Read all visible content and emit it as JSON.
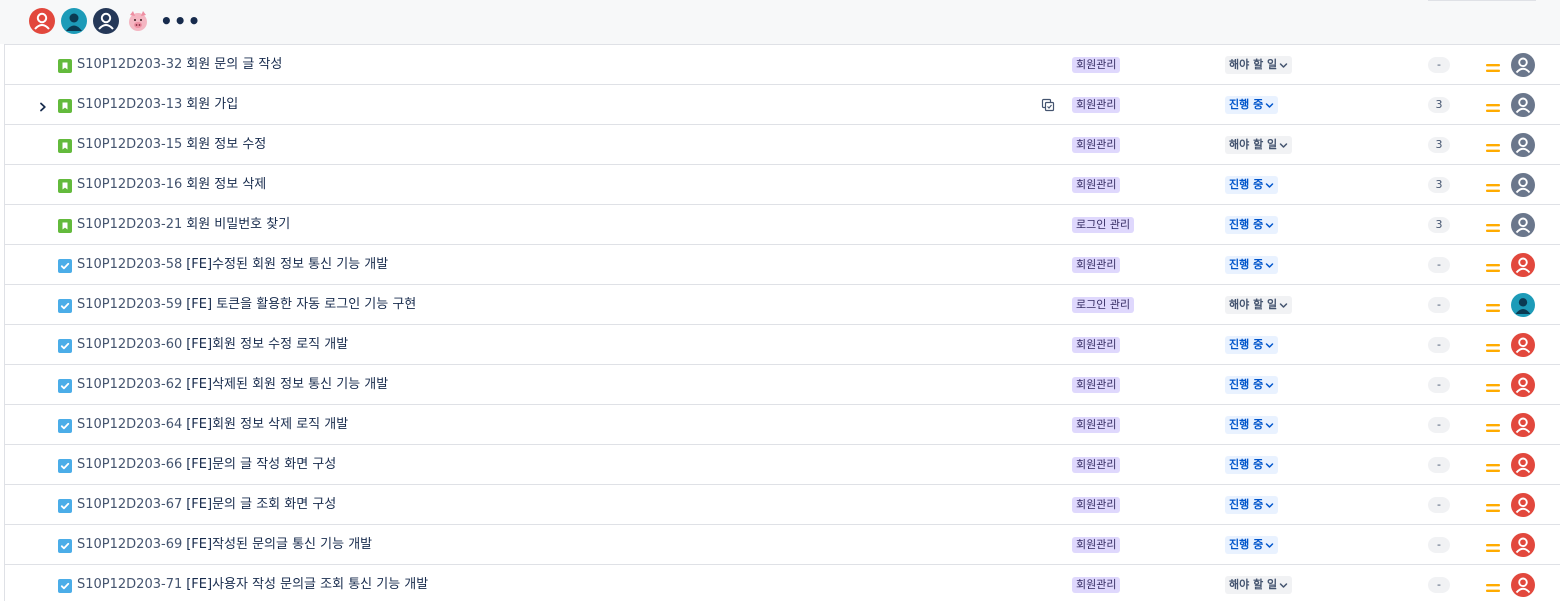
{
  "header": {
    "avatars": [
      {
        "name": "user-avatar-orange",
        "color": "#e2483d"
      },
      {
        "name": "user-avatar-teal",
        "color": "#1d9bb8"
      },
      {
        "name": "user-avatar-navy",
        "color": "#253858"
      },
      {
        "name": "user-avatar-pig",
        "color": "#f4b6c2"
      }
    ],
    "more_label": "•••"
  },
  "colors": {
    "story_icon": "#63ba3c",
    "task_icon": "#4bade8",
    "priority_medium": "#ffab00",
    "label_bg": "#dfd8fd",
    "unassigned_avatar": "#6b778c"
  },
  "rows": [
    {
      "type": "story",
      "key": "S10P12D203-32",
      "summary": "회원 문의 글 작성",
      "label": "회원관리",
      "status": "해야 할 일",
      "status_type": "todo",
      "count": "-",
      "assignee": "unassigned",
      "has_children": false,
      "has_subtask_icon": false
    },
    {
      "type": "story",
      "key": "S10P12D203-13",
      "summary": "회원 가입",
      "label": "회원관리",
      "status": "진행 중",
      "status_type": "progress",
      "count": "3",
      "assignee": "unassigned",
      "has_children": true,
      "has_subtask_icon": true
    },
    {
      "type": "story",
      "key": "S10P12D203-15",
      "summary": "회원 정보 수정",
      "label": "회원관리",
      "status": "해야 할 일",
      "status_type": "todo",
      "count": "3",
      "assignee": "unassigned",
      "has_children": false,
      "has_subtask_icon": false
    },
    {
      "type": "story",
      "key": "S10P12D203-16",
      "summary": "회원 정보 삭제",
      "label": "회원관리",
      "status": "진행 중",
      "status_type": "progress",
      "count": "3",
      "assignee": "unassigned",
      "has_children": false,
      "has_subtask_icon": false
    },
    {
      "type": "story",
      "key": "S10P12D203-21",
      "summary": "회원 비밀번호 찾기",
      "label": "로그인 관리",
      "status": "진행 중",
      "status_type": "progress",
      "count": "3",
      "assignee": "unassigned",
      "has_children": false,
      "has_subtask_icon": false
    },
    {
      "type": "task",
      "key": "S10P12D203-58",
      "summary": "[FE]수정된 회원 정보 통신 기능 개발",
      "label": "회원관리",
      "status": "진행 중",
      "status_type": "progress",
      "count": "-",
      "assignee": "orange",
      "has_children": false,
      "has_subtask_icon": false
    },
    {
      "type": "task",
      "key": "S10P12D203-59",
      "summary": "[FE] 토큰을 활용한 자동 로그인 기능 구현",
      "label": "로그인 관리",
      "status": "해야 할 일",
      "status_type": "todo",
      "count": "-",
      "assignee": "teal",
      "has_children": false,
      "has_subtask_icon": false
    },
    {
      "type": "task",
      "key": "S10P12D203-60",
      "summary": "[FE]회원 정보 수정 로직 개발",
      "label": "회원관리",
      "status": "진행 중",
      "status_type": "progress",
      "count": "-",
      "assignee": "orange",
      "has_children": false,
      "has_subtask_icon": false
    },
    {
      "type": "task",
      "key": "S10P12D203-62",
      "summary": "[FE]삭제된 회원 정보 통신 기능 개발",
      "label": "회원관리",
      "status": "진행 중",
      "status_type": "progress",
      "count": "-",
      "assignee": "orange",
      "has_children": false,
      "has_subtask_icon": false
    },
    {
      "type": "task",
      "key": "S10P12D203-64",
      "summary": "[FE]회원 정보 삭제 로직 개발",
      "label": "회원관리",
      "status": "진행 중",
      "status_type": "progress",
      "count": "-",
      "assignee": "orange",
      "has_children": false,
      "has_subtask_icon": false
    },
    {
      "type": "task",
      "key": "S10P12D203-66",
      "summary": "[FE]문의 글 작성 화면 구성",
      "label": "회원관리",
      "status": "진행 중",
      "status_type": "progress",
      "count": "-",
      "assignee": "orange",
      "has_children": false,
      "has_subtask_icon": false
    },
    {
      "type": "task",
      "key": "S10P12D203-67",
      "summary": "[FE]문의 글 조회 화면 구성",
      "label": "회원관리",
      "status": "진행 중",
      "status_type": "progress",
      "count": "-",
      "assignee": "orange",
      "has_children": false,
      "has_subtask_icon": false
    },
    {
      "type": "task",
      "key": "S10P12D203-69",
      "summary": "[FE]작성된 문의글 통신 기능 개발",
      "label": "회원관리",
      "status": "진행 중",
      "status_type": "progress",
      "count": "-",
      "assignee": "orange",
      "has_children": false,
      "has_subtask_icon": false
    },
    {
      "type": "task",
      "key": "S10P12D203-71",
      "summary": "[FE]사용자 작성 문의글 조회 통신 기능 개발",
      "label": "회원관리",
      "status": "해야 할 일",
      "status_type": "todo",
      "count": "-",
      "assignee": "orange",
      "has_children": false,
      "has_subtask_icon": false
    }
  ]
}
